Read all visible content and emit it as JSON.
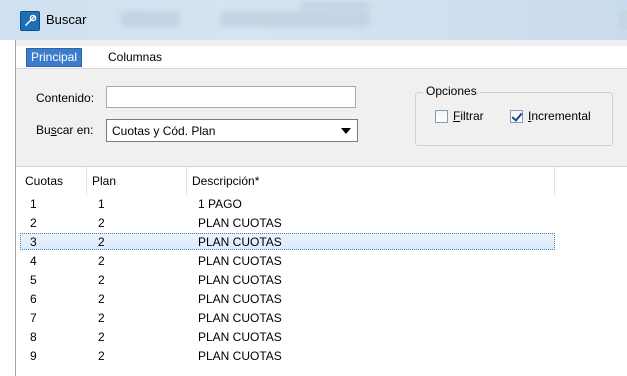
{
  "window": {
    "title": "Buscar"
  },
  "tabs": [
    {
      "label": "Principal",
      "active": true
    },
    {
      "label": "Columnas",
      "active": false
    }
  ],
  "search": {
    "contenido_label": "Contenido:",
    "contenido_value": "",
    "buscar_en_label": "Buscar en:",
    "buscar_en_value": "Cuotas y Cód. Plan"
  },
  "options": {
    "legend": "Opciones",
    "filtrar": {
      "label": "Filtrar",
      "checked": false
    },
    "incremental": {
      "label": "Incremental",
      "checked": true
    }
  },
  "grid": {
    "columns": [
      "Cuotas",
      "Plan",
      "Descripción*"
    ],
    "rows": [
      {
        "cuotas": "1",
        "plan": "1",
        "descripcion": "1 PAGO"
      },
      {
        "cuotas": "2",
        "plan": "2",
        "descripcion": "PLAN CUOTAS"
      },
      {
        "cuotas": "3",
        "plan": "2",
        "descripcion": "PLAN CUOTAS",
        "selected": true
      },
      {
        "cuotas": "4",
        "plan": "2",
        "descripcion": "PLAN CUOTAS"
      },
      {
        "cuotas": "5",
        "plan": "2",
        "descripcion": "PLAN CUOTAS"
      },
      {
        "cuotas": "6",
        "plan": "2",
        "descripcion": "PLAN CUOTAS"
      },
      {
        "cuotas": "7",
        "plan": "2",
        "descripcion": "PLAN CUOTAS"
      },
      {
        "cuotas": "8",
        "plan": "2",
        "descripcion": "PLAN CUOTAS"
      },
      {
        "cuotas": "9",
        "plan": "2",
        "descripcion": "PLAN CUOTAS"
      }
    ]
  },
  "colors": {
    "tab_active_bg": "#3b7ccc",
    "selection": "#d9ebfb"
  }
}
